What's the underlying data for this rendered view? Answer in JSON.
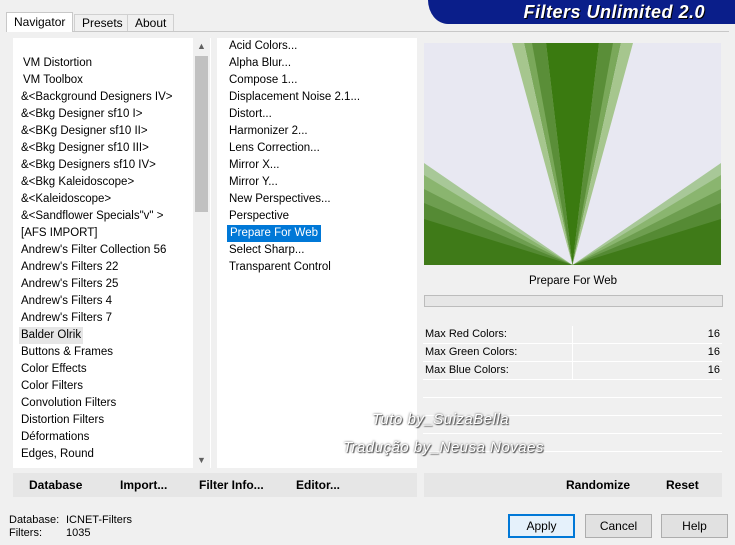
{
  "banner": {
    "title": "Filters Unlimited 2.0"
  },
  "tabs": [
    {
      "label": "Navigator"
    },
    {
      "label": "Presets"
    },
    {
      "label": "About"
    }
  ],
  "categories": [
    "VM Distortion",
    "VM Toolbox",
    "&<Background Designers IV>",
    "&<Bkg Designer sf10 I>",
    "&<BKg Designer sf10 II>",
    "&<Bkg Designer sf10 III>",
    "&<Bkg Designers sf10 IV>",
    "&<Bkg Kaleidoscope>",
    "&<Kaleidoscope>",
    "&<Sandflower Specials\"v\" >",
    "[AFS IMPORT]",
    "Andrew's Filter Collection 56",
    "Andrew's Filters 22",
    "Andrew's Filters 25",
    "Andrew's Filters 4",
    "Andrew's Filters 7",
    "Balder Olrik",
    "Buttons & Frames",
    "Color Effects",
    "Color Filters",
    "Convolution Filters",
    "Distortion Filters",
    "Déformations",
    "Edges, Round"
  ],
  "selected_category": "Balder Olrik",
  "filters": [
    "Acid Colors...",
    "Alpha Blur...",
    "Compose 1...",
    "Displacement Noise 2.1...",
    "Distort...",
    "Harmonizer 2...",
    "Lens Correction...",
    "Mirror X...",
    "Mirror Y...",
    "New Perspectives...",
    "Perspective",
    "Prepare For Web",
    "Select Sharp...",
    "Transparent Control"
  ],
  "selected_filter": "Prepare For Web",
  "preview": {
    "filter_name": "Prepare For Web",
    "colors": {
      "green": "#3a7a10",
      "background": "#e8e8f2"
    }
  },
  "params": [
    {
      "label": "Max Red Colors:",
      "value": "16"
    },
    {
      "label": "Max Green Colors:",
      "value": "16"
    },
    {
      "label": "Max Blue Colors:",
      "value": "16"
    }
  ],
  "watermark": {
    "line1": "Tuto by_SuizaBella",
    "line2": "Tradução by_Neusa Novaes"
  },
  "toolbar": {
    "database": "Database",
    "import": "Import...",
    "filter_info": "Filter Info...",
    "editor": "Editor...",
    "randomize": "Randomize",
    "reset": "Reset"
  },
  "status": {
    "database_label": "Database:",
    "database_value": "ICNET-Filters",
    "filters_label": "Filters:",
    "filters_value": "1035"
  },
  "buttons": {
    "apply": "Apply",
    "cancel": "Cancel",
    "help": "Help"
  }
}
